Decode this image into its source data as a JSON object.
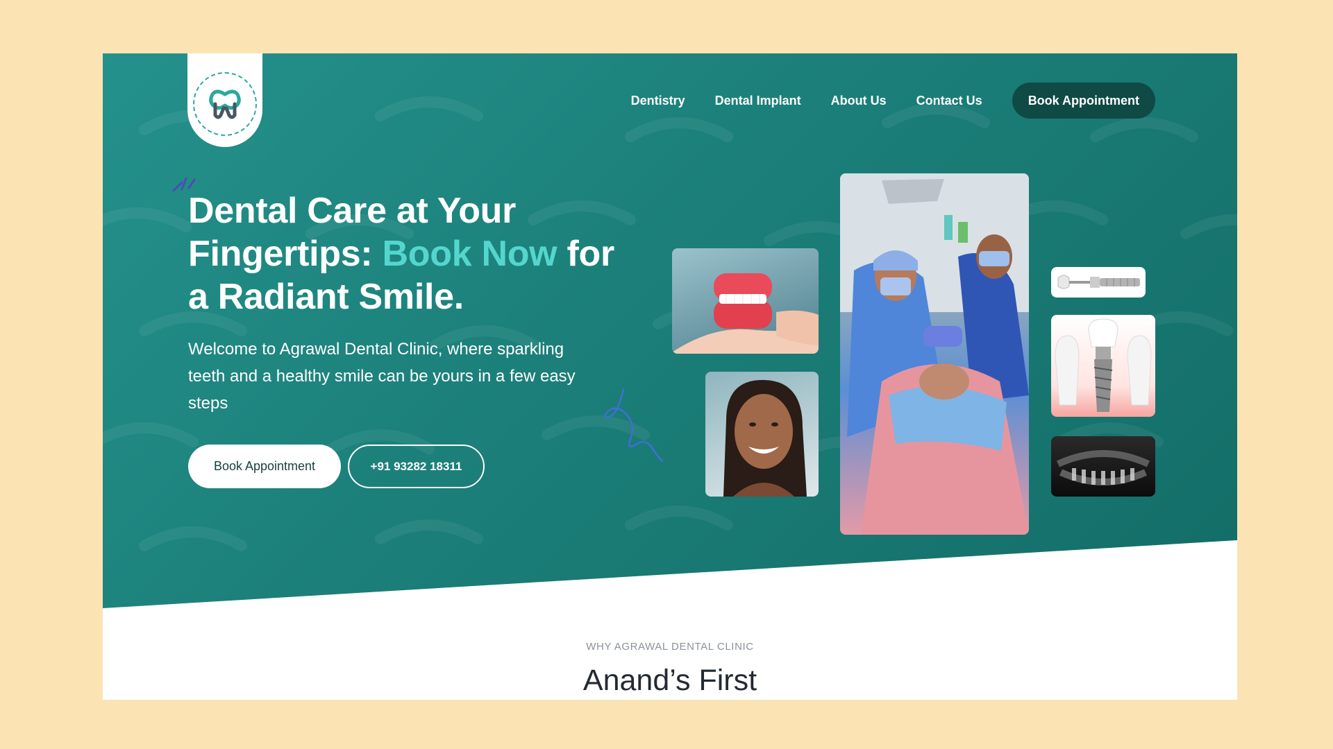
{
  "site": {
    "brand_logo": "tooth-logo"
  },
  "nav": {
    "items": [
      {
        "label": "Dentistry"
      },
      {
        "label": "Dental Implant"
      },
      {
        "label": "About Us"
      },
      {
        "label": "Contact Us"
      }
    ],
    "cta_label": "Book Appointment"
  },
  "hero": {
    "title_part1": "Dental Care at Your Fingertips: ",
    "title_accent": "Book Now",
    "title_part2": " for a Radiant Smile.",
    "intro": "Welcome to Agrawal Dental Clinic, where sparkling teeth and a healthy smile can be yours in a few easy steps",
    "primary_button": "Book Appointment",
    "phone_button": "+91 93282 18311"
  },
  "section": {
    "eyebrow": "WHY AGRAWAL DENTAL CLINIC",
    "heading": "Anand’s First"
  },
  "colors": {
    "page_bg": "#fbe3b4",
    "hero_teal": "#1c7f79",
    "accent": "#54d6ce",
    "dark_button": "#0f4a45"
  }
}
